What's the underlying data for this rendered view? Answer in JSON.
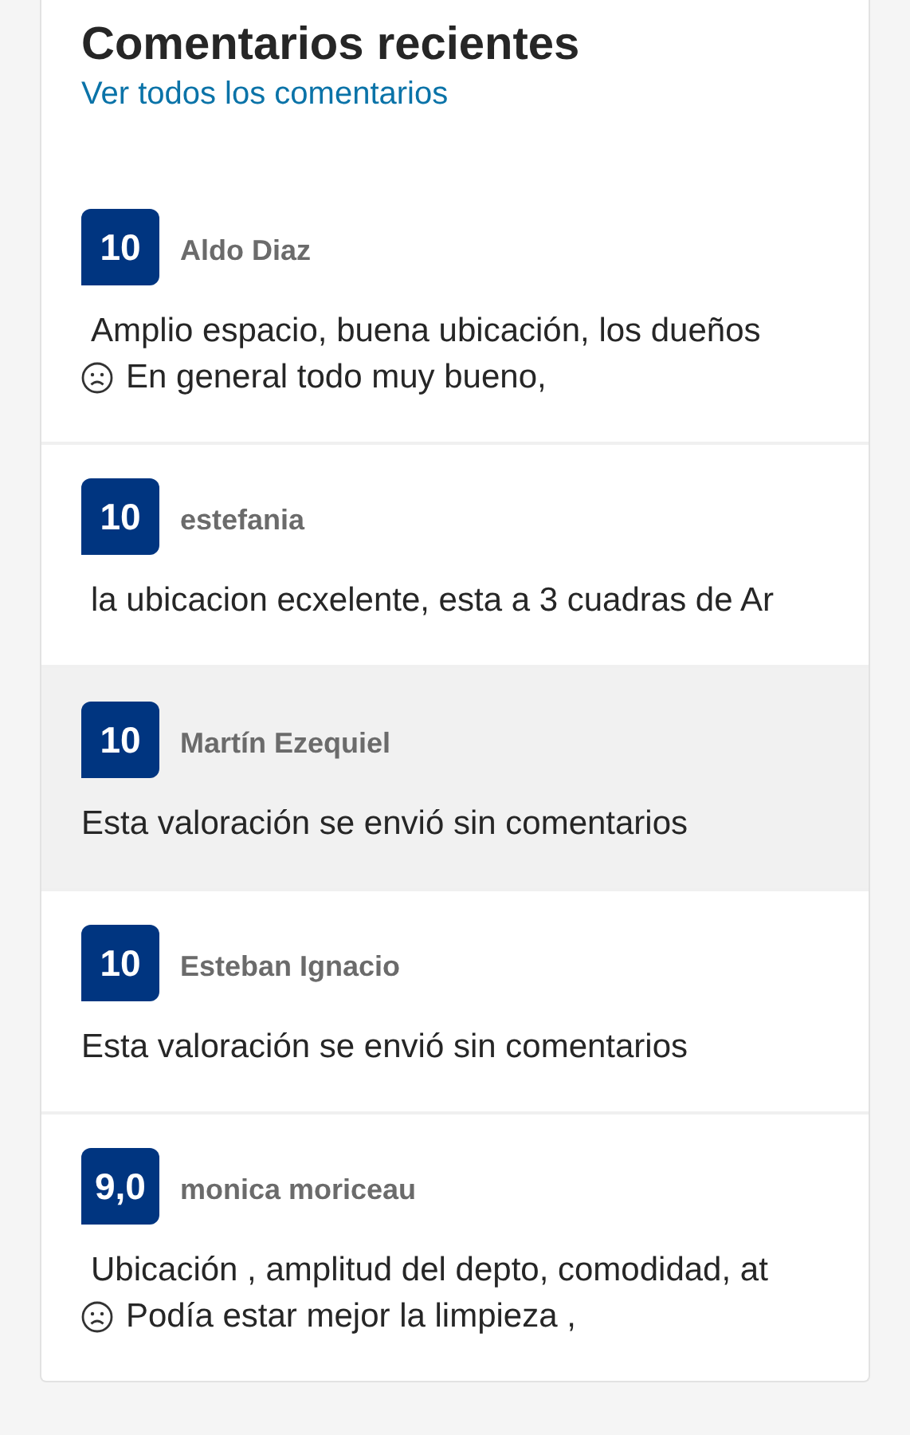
{
  "title": "Comentarios recientes",
  "link": "Ver todos los comentarios",
  "reviews": [
    {
      "score": "10",
      "name": "Aldo Diaz",
      "selected": false,
      "lines": [
        {
          "kind": "positive",
          "text": "Amplio espacio, buena ubicación, los dueños"
        },
        {
          "kind": "negative",
          "text": "En general todo muy bueno,"
        }
      ]
    },
    {
      "score": "10",
      "name": "estefania",
      "selected": false,
      "lines": [
        {
          "kind": "positive",
          "text": "la ubicacion ecxelente, esta a 3 cuadras de Ar"
        }
      ]
    },
    {
      "score": "10",
      "name": "Martín Ezequiel",
      "selected": true,
      "lines": [
        {
          "kind": "empty",
          "text": "Esta valoración se envió sin comentarios"
        }
      ]
    },
    {
      "score": "10",
      "name": "Esteban Ignacio",
      "selected": false,
      "lines": [
        {
          "kind": "empty",
          "text": "Esta valoración se envió sin comentarios"
        }
      ]
    },
    {
      "score": "9,0",
      "name": "monica moriceau",
      "selected": false,
      "lines": [
        {
          "kind": "positive",
          "text": "Ubicación , amplitud del depto, comodidad, at"
        },
        {
          "kind": "negative",
          "text": "Podía estar mejor la limpieza ,"
        }
      ]
    }
  ]
}
